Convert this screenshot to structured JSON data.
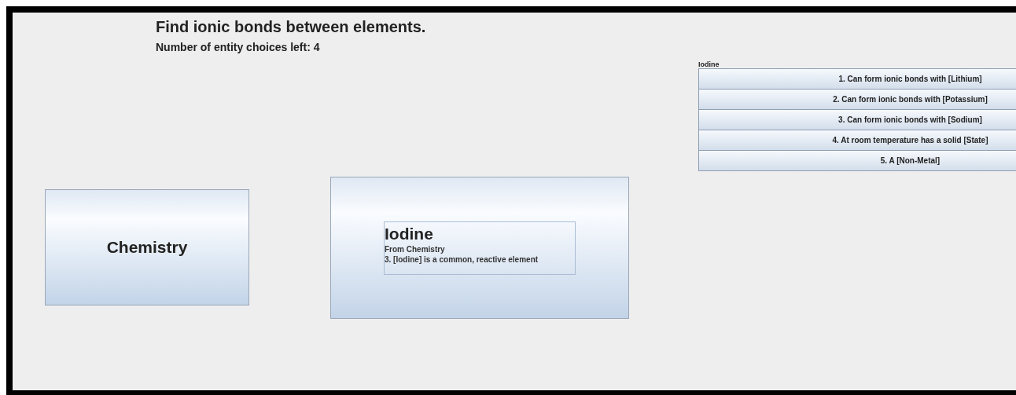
{
  "header": {
    "title": "Find ionic bonds between elements.",
    "subtitle": "Number of entity choices left: 4"
  },
  "source_card": {
    "label": "Chemistry"
  },
  "entity_card": {
    "name": "Iodine",
    "origin": "From Chemistry",
    "fact": "3. [Iodine] is a common, reactive element"
  },
  "choices": {
    "title": "Iodine",
    "items": [
      {
        "label": "1. Can form ionic bonds with [Lithium]"
      },
      {
        "label": "2. Can form ionic bonds with [Potassium]"
      },
      {
        "label": "3. Can form ionic bonds with [Sodium]"
      },
      {
        "label": "4. At room temperature has a solid [State]"
      },
      {
        "label": "5. A [Non-Metal]"
      }
    ]
  }
}
